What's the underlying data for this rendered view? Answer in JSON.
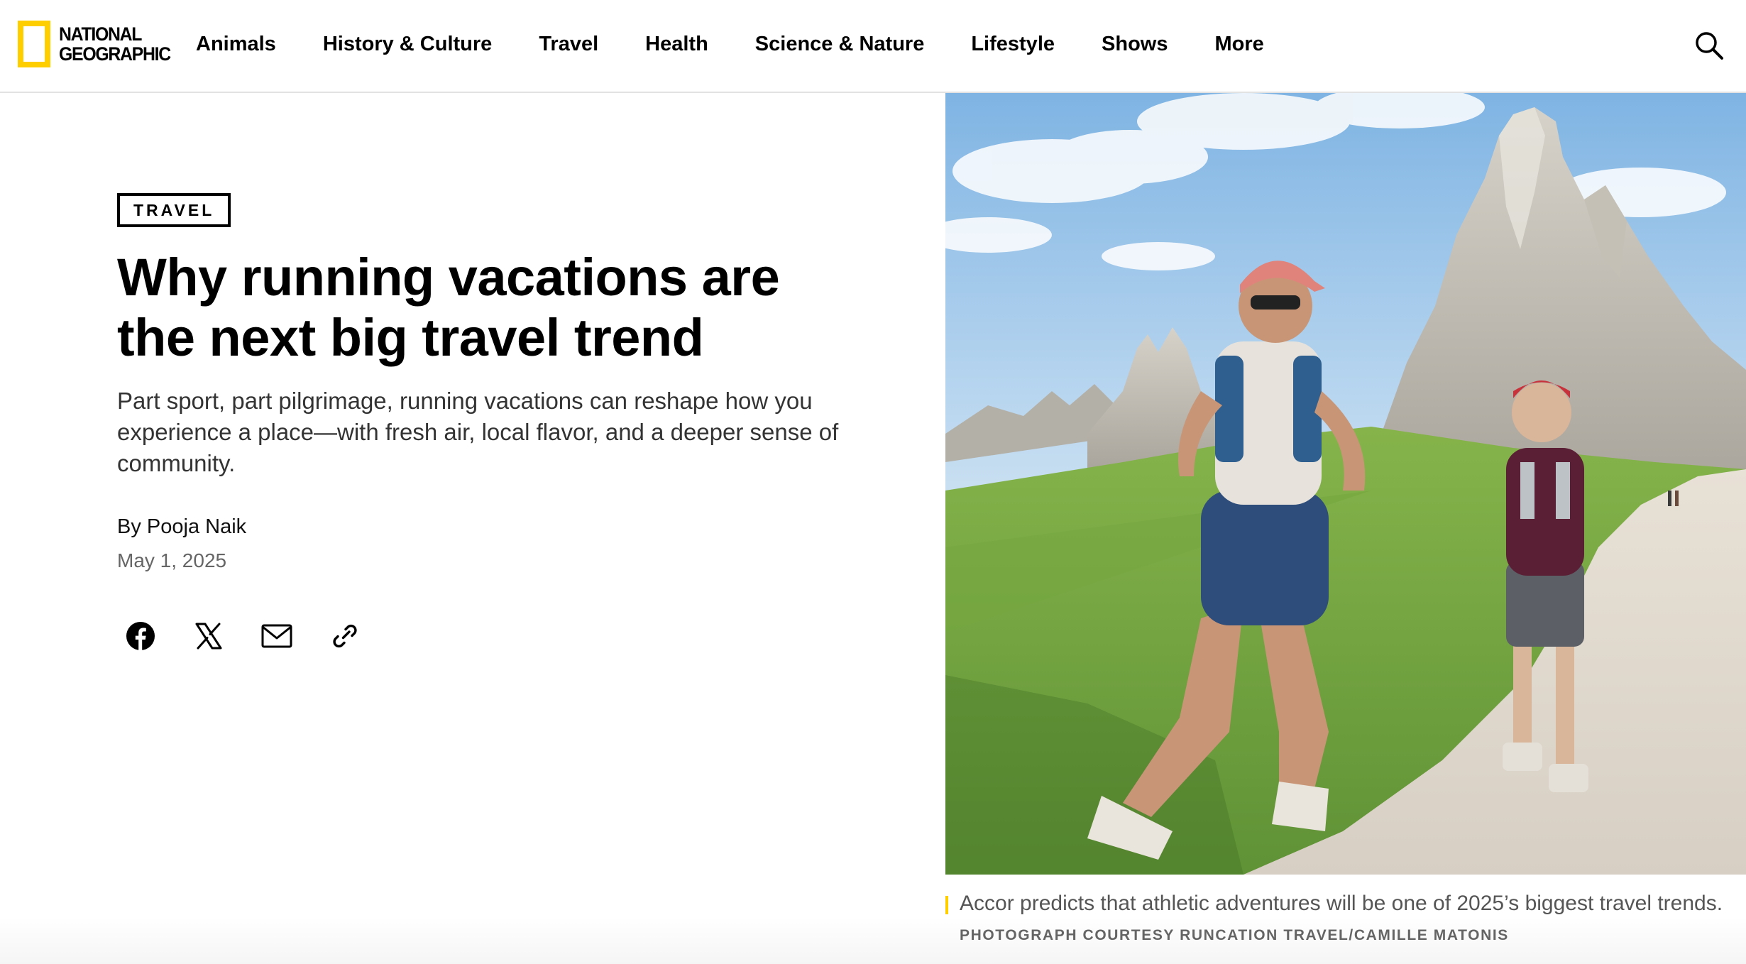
{
  "brand": {
    "logo_line1": "NATIONAL",
    "logo_line2": "GEOGRAPHIC",
    "accent_color": "#ffce00"
  },
  "nav": {
    "items": [
      {
        "label": "Animals"
      },
      {
        "label": "History & Culture"
      },
      {
        "label": "Travel"
      },
      {
        "label": "Health"
      },
      {
        "label": "Science & Nature"
      },
      {
        "label": "Lifestyle"
      },
      {
        "label": "Shows"
      },
      {
        "label": "More"
      }
    ],
    "search_icon": "search-icon"
  },
  "article": {
    "tag": "TRAVEL",
    "headline_line1": "Why running vacations are",
    "headline_line2": "the next big travel trend",
    "dek": "Part sport, part pilgrimage, running vacations can reshape how you experience a place—with fresh air, local flavor, and a deeper sense of community.",
    "byline_prefix": "By",
    "author": "Pooja Naik",
    "date": "May 1, 2025",
    "share_icons": [
      "facebook-icon",
      "x-icon",
      "email-icon",
      "link-icon"
    ]
  },
  "photo": {
    "caption": "Accor predicts that athletic adventures will be one of 2025’s biggest travel trends.",
    "credit": "PHOTOGRAPH COURTESY RUNCATION TRAVEL/CAMILLE MATONIS"
  }
}
